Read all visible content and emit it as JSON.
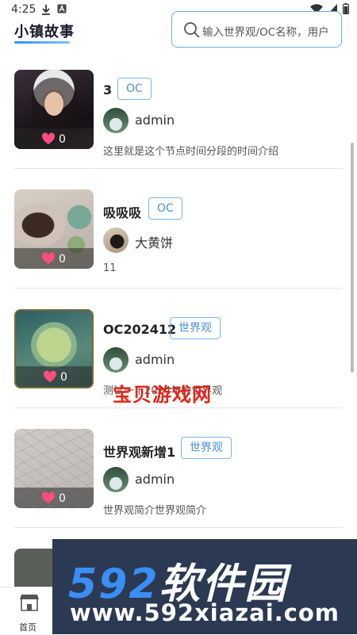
{
  "status_bar": {
    "time": "4:25"
  },
  "header": {
    "brand": "小镇故事",
    "search_placeholder": "输入世界观/OC名称，用户"
  },
  "items": [
    {
      "title": "3",
      "tag": "OC",
      "author": "admin",
      "likes": "0",
      "description": "这里就是这个节点时间分段的时间介绍"
    },
    {
      "title": "吸吸吸",
      "tag": "OC",
      "author": "大黄饼",
      "likes": "0",
      "description": "11"
    },
    {
      "title": "OC202412",
      "tag": "世界观",
      "author": "admin",
      "likes": "0",
      "description": "测试一下2024年的世界观"
    },
    {
      "title": "世界观新增1",
      "tag": "世界观",
      "author": "admin",
      "likes": "0",
      "description": "世界观简介世界观简介"
    }
  ],
  "tabbar": {
    "home_label": "首页"
  },
  "watermarks": {
    "red_text": "宝贝游戏网",
    "banner_brand_num": "592",
    "banner_brand_cn": "软件园",
    "banner_url": "www.592xiazai.com"
  },
  "colors": {
    "accent": "#4a90d6",
    "like": "#ff4d7d",
    "watermark_red": "#e0261b"
  }
}
